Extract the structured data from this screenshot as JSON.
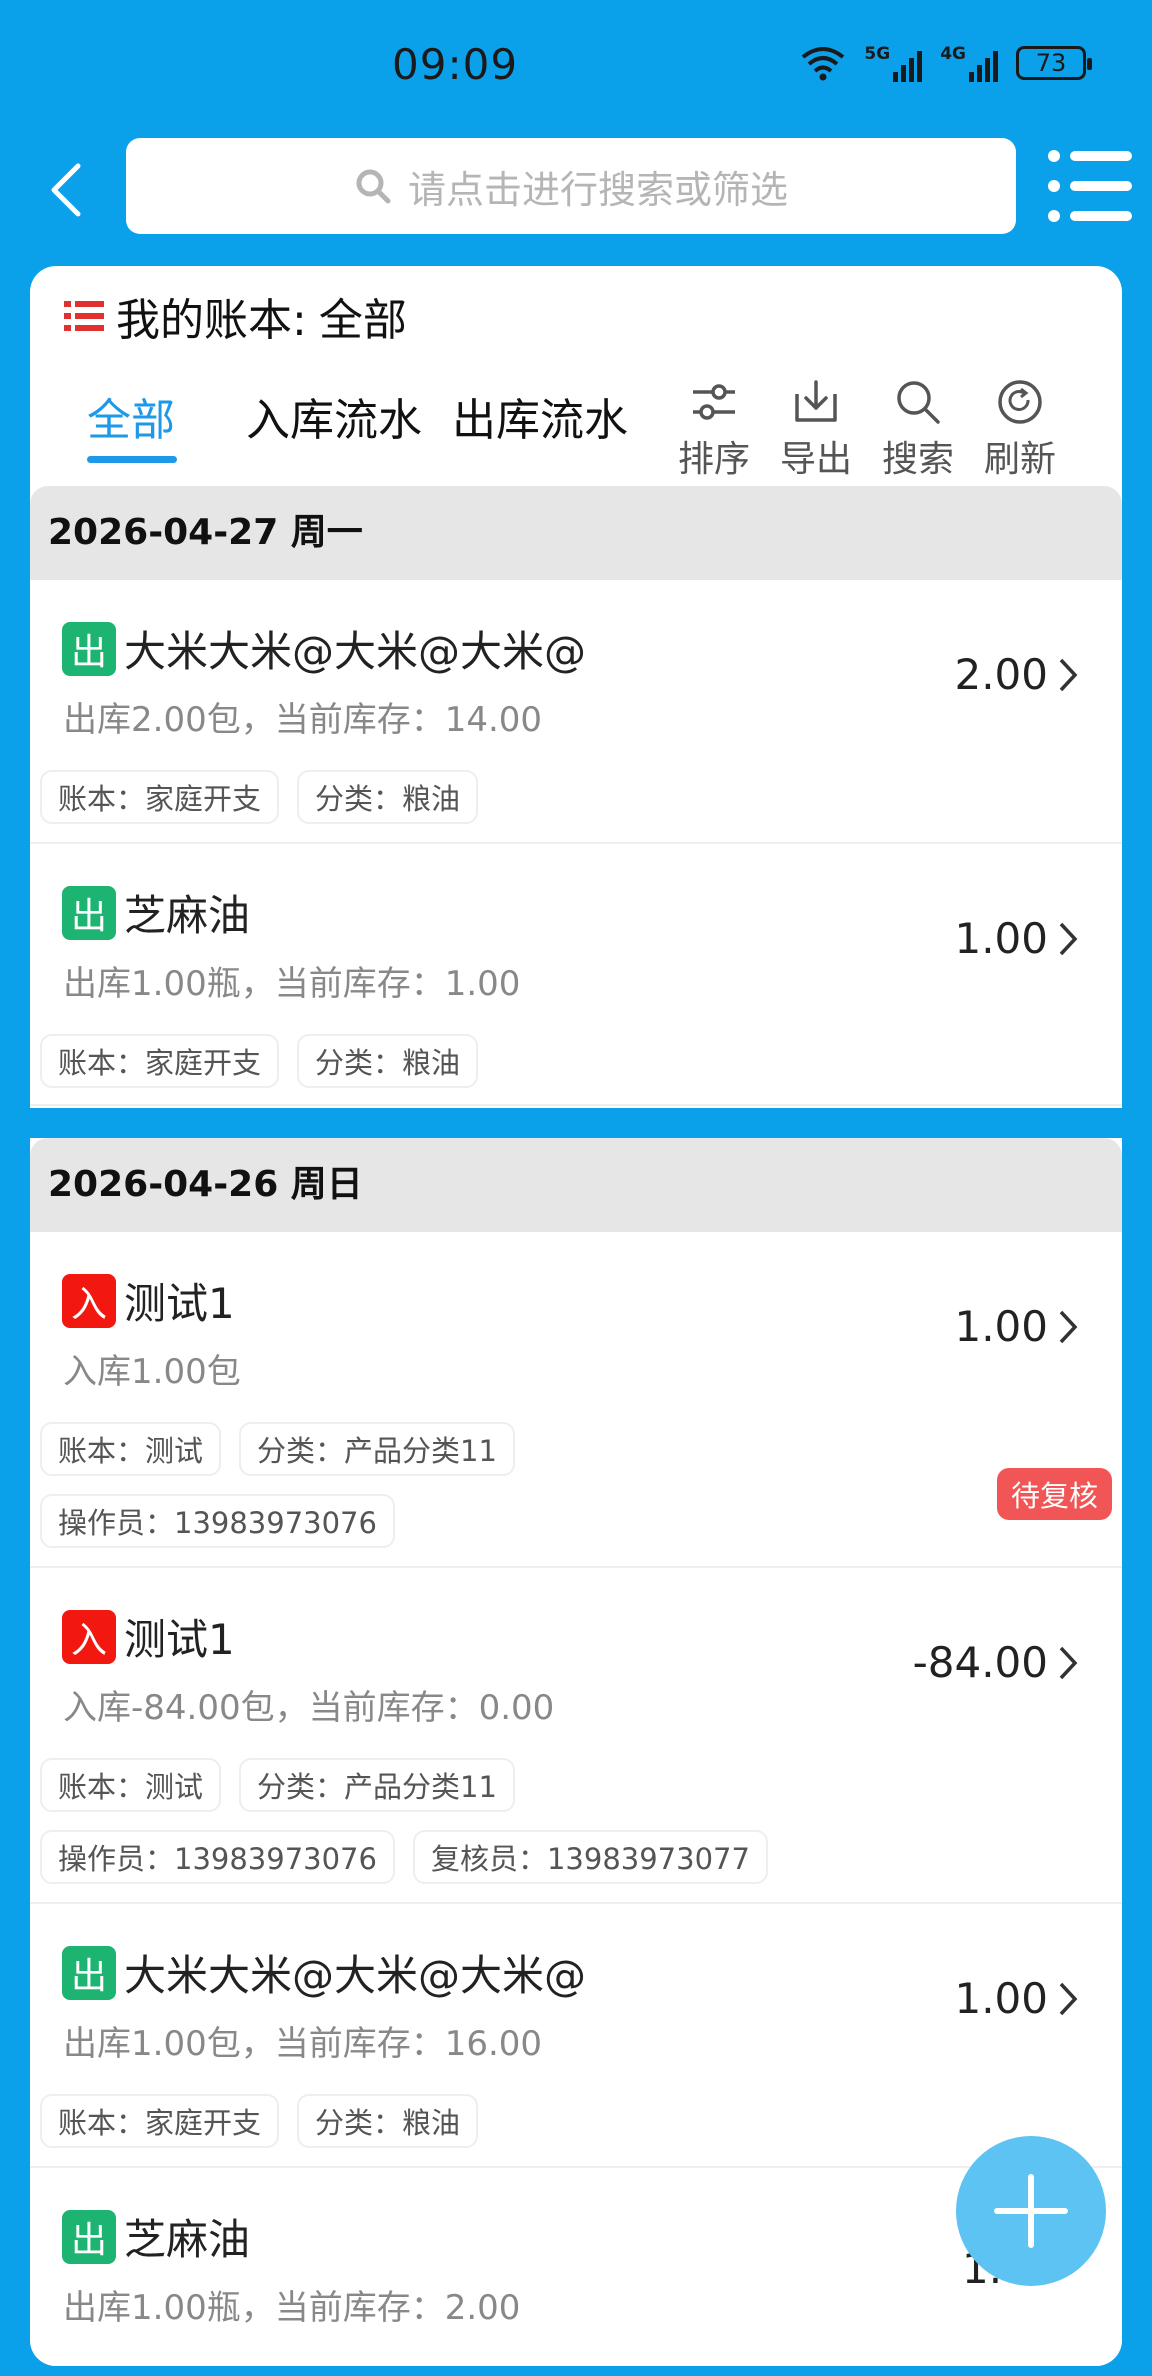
{
  "status_bar": {
    "time": "09:09",
    "battery": "73",
    "net1": "5G",
    "net2": "4G"
  },
  "search": {
    "placeholder": "请点击进行搜索或筛选"
  },
  "book": {
    "label": "我的账本:",
    "value": "全部"
  },
  "tabs": [
    {
      "label": "全部",
      "active": true
    },
    {
      "label": "入库流水",
      "active": false
    },
    {
      "label": "出库流水",
      "active": false
    }
  ],
  "tools": {
    "sort": "排序",
    "export": "导出",
    "search": "搜索",
    "refresh": "刷新"
  },
  "days": [
    {
      "date": "2026-04-27 周一"
    },
    {
      "date": "2026-04-26 周日"
    }
  ],
  "records": [
    {
      "type": "出",
      "name": "大米大米@大米@大米@",
      "detail": "出库2.00包，当前库存：14.00",
      "amount": "2.00",
      "tags": [
        "账本：家庭开支",
        "分类：粮油"
      ]
    },
    {
      "type": "出",
      "name": "芝麻油",
      "detail": "出库1.00瓶，当前库存：1.00",
      "amount": "1.00",
      "tags": [
        "账本：家庭开支",
        "分类：粮油"
      ]
    },
    {
      "type": "入",
      "name": "测试1",
      "detail": "入库1.00包",
      "amount": "1.00",
      "tags": [
        "账本：测试",
        "分类：产品分类11"
      ],
      "tags2": [
        "操作员：13983973076"
      ],
      "status": "待复核"
    },
    {
      "type": "入",
      "name": "测试1",
      "detail": "入库-84.00包，当前库存：0.00",
      "amount": "-84.00",
      "tags": [
        "账本：测试",
        "分类：产品分类11"
      ],
      "tags2": [
        "操作员：13983973076",
        "复核员：13983973077"
      ]
    },
    {
      "type": "出",
      "name": "大米大米@大米@大米@",
      "detail": "出库1.00包，当前库存：16.00",
      "amount": "1.00",
      "tags": [
        "账本：家庭开支",
        "分类：粮油"
      ]
    },
    {
      "type": "出",
      "name": "芝麻油",
      "detail": "出库1.00瓶，当前库存：2.00",
      "amount": "1.",
      "tags": []
    }
  ],
  "colors": {
    "primary": "#0AA0EA",
    "accent": "#1E98E8",
    "out_badge": "#1DB472",
    "in_badge": "#F2180F",
    "pending": "#F25555"
  }
}
